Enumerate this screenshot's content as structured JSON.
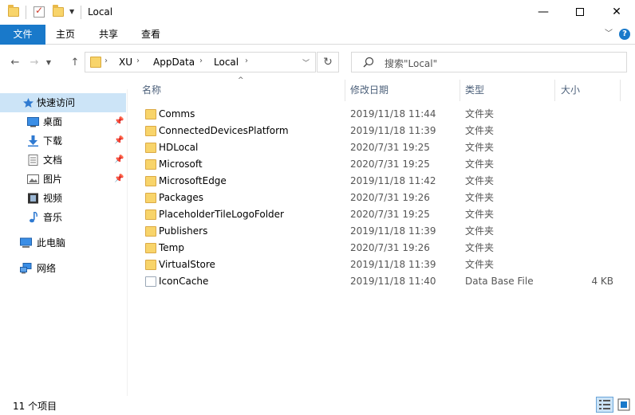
{
  "window": {
    "title": "Local",
    "minimize_glyph": "—",
    "close_glyph": "✕"
  },
  "ribbon": {
    "tabs": [
      {
        "label": "文件"
      },
      {
        "label": "主页"
      },
      {
        "label": "共享"
      },
      {
        "label": "查看"
      }
    ],
    "help_glyph": "?"
  },
  "address": {
    "breadcrumbs": [
      "XU",
      "AppData",
      "Local"
    ],
    "separator": "›"
  },
  "search": {
    "placeholder": "搜索\"Local\""
  },
  "nav_pane": {
    "items": [
      {
        "label": "快速访问",
        "icon": "star-icon",
        "pinned": false
      },
      {
        "label": "桌面",
        "icon": "desktop-icon",
        "pinned": true
      },
      {
        "label": "下载",
        "icon": "download-icon",
        "pinned": true
      },
      {
        "label": "文档",
        "icon": "documents-icon",
        "pinned": true
      },
      {
        "label": "图片",
        "icon": "pictures-icon",
        "pinned": true
      },
      {
        "label": "视频",
        "icon": "videos-icon",
        "pinned": false
      },
      {
        "label": "音乐",
        "icon": "music-icon",
        "pinned": false
      },
      {
        "label": "此电脑",
        "icon": "computer-icon",
        "pinned": false
      },
      {
        "label": "网络",
        "icon": "network-icon",
        "pinned": false
      }
    ]
  },
  "columns": {
    "name": "名称",
    "date": "修改日期",
    "type": "类型",
    "size": "大小"
  },
  "files": [
    {
      "name": "Comms",
      "date": "2019/11/18 11:44",
      "type": "文件夹",
      "size": "",
      "kind": "folder"
    },
    {
      "name": "ConnectedDevicesPlatform",
      "date": "2019/11/18 11:39",
      "type": "文件夹",
      "size": "",
      "kind": "folder"
    },
    {
      "name": "HDLocal",
      "date": "2020/7/31 19:25",
      "type": "文件夹",
      "size": "",
      "kind": "folder"
    },
    {
      "name": "Microsoft",
      "date": "2020/7/31 19:25",
      "type": "文件夹",
      "size": "",
      "kind": "folder"
    },
    {
      "name": "MicrosoftEdge",
      "date": "2019/11/18 11:42",
      "type": "文件夹",
      "size": "",
      "kind": "folder"
    },
    {
      "name": "Packages",
      "date": "2020/7/31 19:26",
      "type": "文件夹",
      "size": "",
      "kind": "folder"
    },
    {
      "name": "PlaceholderTileLogoFolder",
      "date": "2020/7/31 19:25",
      "type": "文件夹",
      "size": "",
      "kind": "folder"
    },
    {
      "name": "Publishers",
      "date": "2019/11/18 11:39",
      "type": "文件夹",
      "size": "",
      "kind": "folder"
    },
    {
      "name": "Temp",
      "date": "2020/7/31 19:26",
      "type": "文件夹",
      "size": "",
      "kind": "folder"
    },
    {
      "name": "VirtualStore",
      "date": "2019/11/18 11:39",
      "type": "文件夹",
      "size": "",
      "kind": "folder"
    },
    {
      "name": "IconCache",
      "date": "2019/11/18 11:40",
      "type": "Data Base File",
      "size": "4 KB",
      "kind": "file"
    }
  ],
  "status": {
    "item_count": "11 个项目"
  },
  "colors": {
    "accent": "#1979ca",
    "selection": "#cce4f7",
    "folder": "#f8d46a"
  }
}
